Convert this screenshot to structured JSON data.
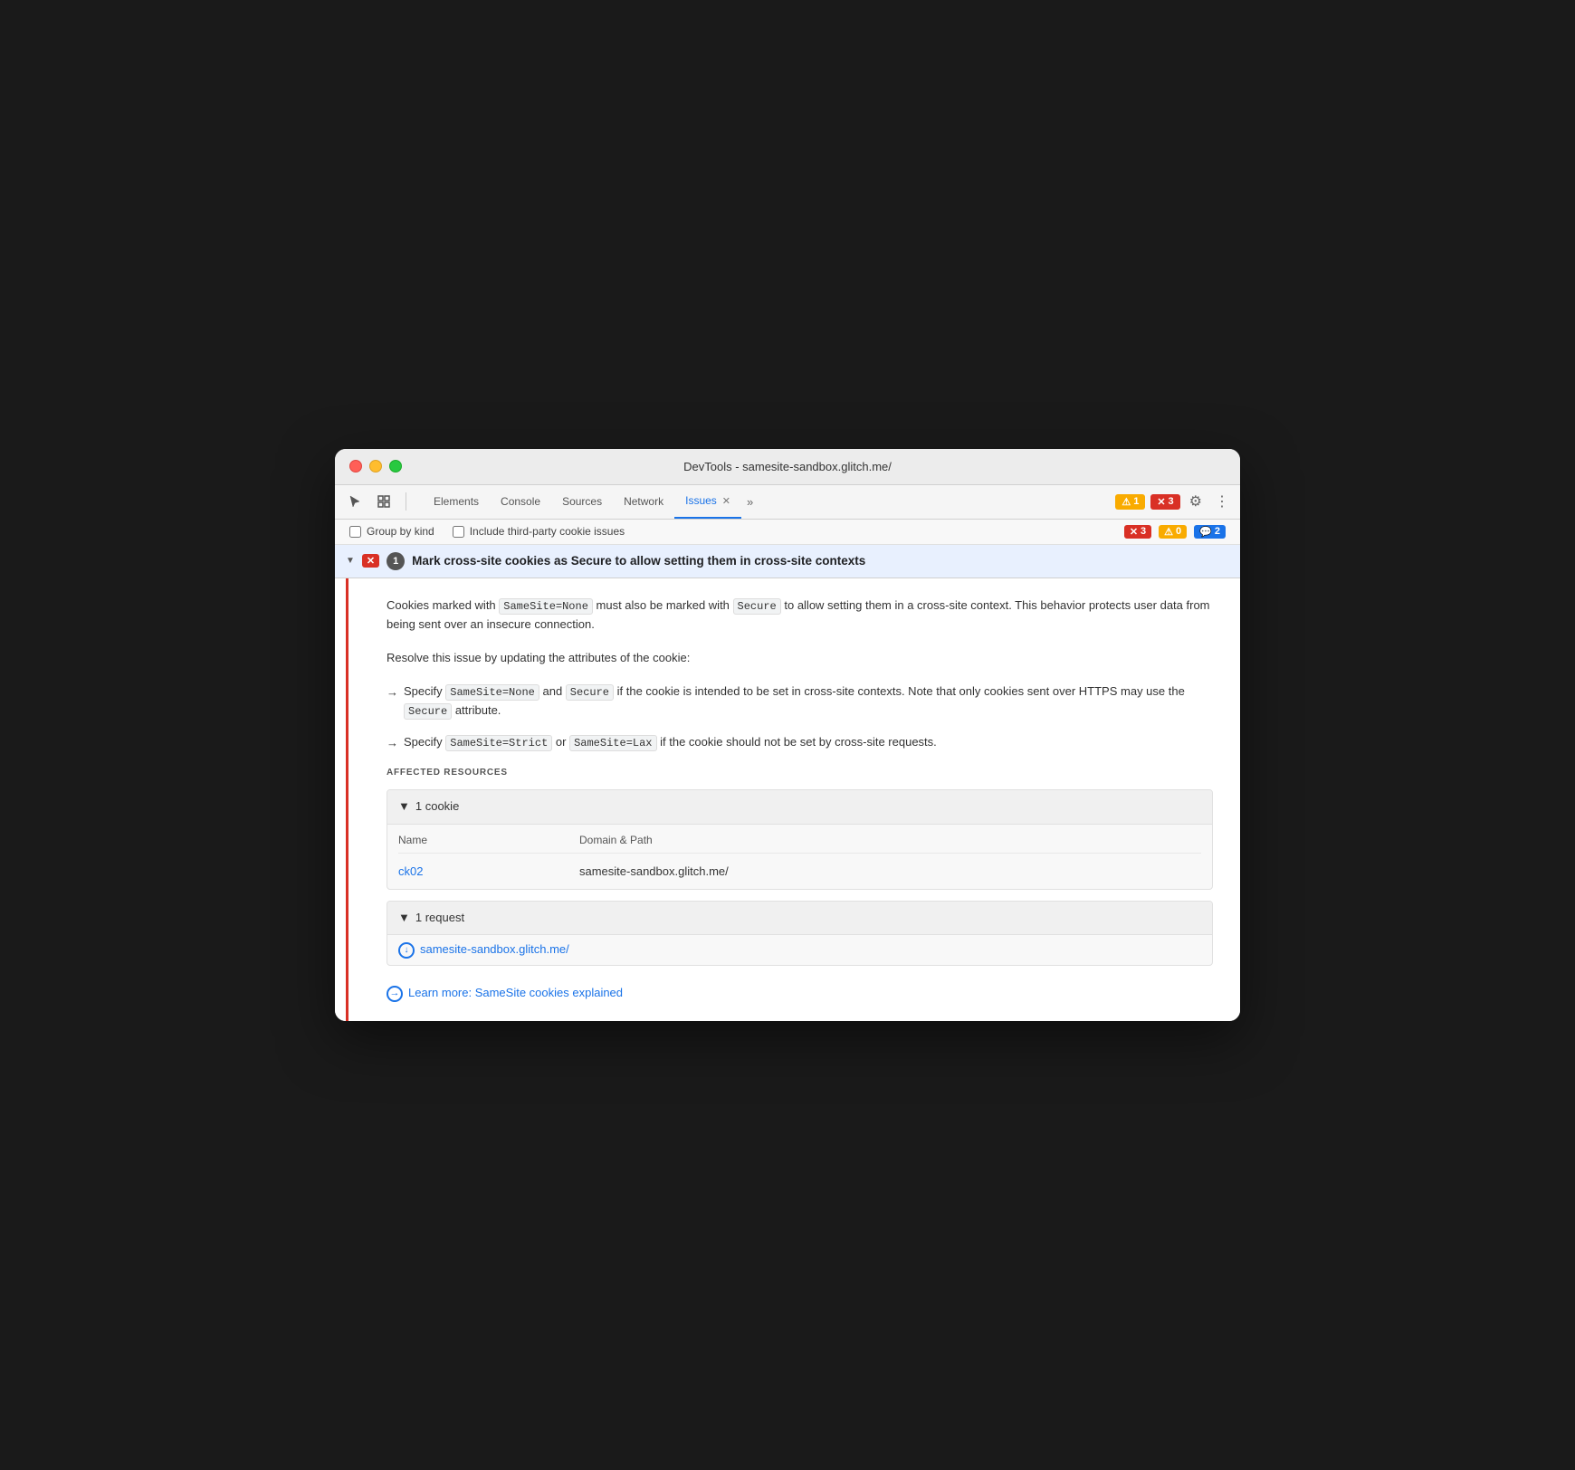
{
  "window": {
    "title": "DevTools - samesite-sandbox.glitch.me/"
  },
  "tabs": [
    {
      "id": "elements",
      "label": "Elements",
      "active": false
    },
    {
      "id": "console",
      "label": "Console",
      "active": false
    },
    {
      "id": "sources",
      "label": "Sources",
      "active": false
    },
    {
      "id": "network",
      "label": "Network",
      "active": false
    },
    {
      "id": "issues",
      "label": "Issues",
      "active": true,
      "closeable": true
    }
  ],
  "tab_overflow_label": "»",
  "badges": {
    "warning_count": "1",
    "error_count": "3"
  },
  "filter_bar": {
    "group_by_kind_label": "Group by kind",
    "include_third_party_label": "Include third-party cookie issues",
    "counts": {
      "errors": "3",
      "warnings": "0",
      "info": "2"
    }
  },
  "issue": {
    "count": "1",
    "title": "Mark cross-site cookies as Secure to allow setting them in cross-site contexts",
    "description": "Cookies marked with SameSite=None must also be marked with Secure to allow setting them in a cross-site context. This behavior protects user data from being sent over an insecure connection.",
    "resolve_text": "Resolve this issue by updating the attributes of the cookie:",
    "bullets": [
      {
        "arrow": "→",
        "prefix": "Specify ",
        "code1": "SameSite=None",
        "middle": " and ",
        "code2": "Secure",
        "suffix1": " if the cookie is intended to be set in cross-site contexts. Note that only cookies sent over HTTPS may use the ",
        "code3": "Secure",
        "suffix2": " attribute."
      },
      {
        "arrow": "→",
        "prefix": "Specify ",
        "code1": "SameSite=Strict",
        "middle": " or ",
        "code2": "SameSite=Lax",
        "suffix": " if the cookie should not be set by cross-site requests."
      }
    ],
    "affected_resources_label": "AFFECTED RESOURCES",
    "cookie_section": {
      "header": "1 cookie",
      "table_headers": {
        "name": "Name",
        "domain_path": "Domain & Path"
      },
      "cookies": [
        {
          "name": "ck02",
          "domain_path": "samesite-sandbox.glitch.me/"
        }
      ]
    },
    "request_section": {
      "header": "1 request",
      "requests": [
        {
          "url": "samesite-sandbox.glitch.me/"
        }
      ]
    },
    "learn_more": {
      "label": "Learn more: SameSite cookies explained",
      "url": "#"
    }
  }
}
